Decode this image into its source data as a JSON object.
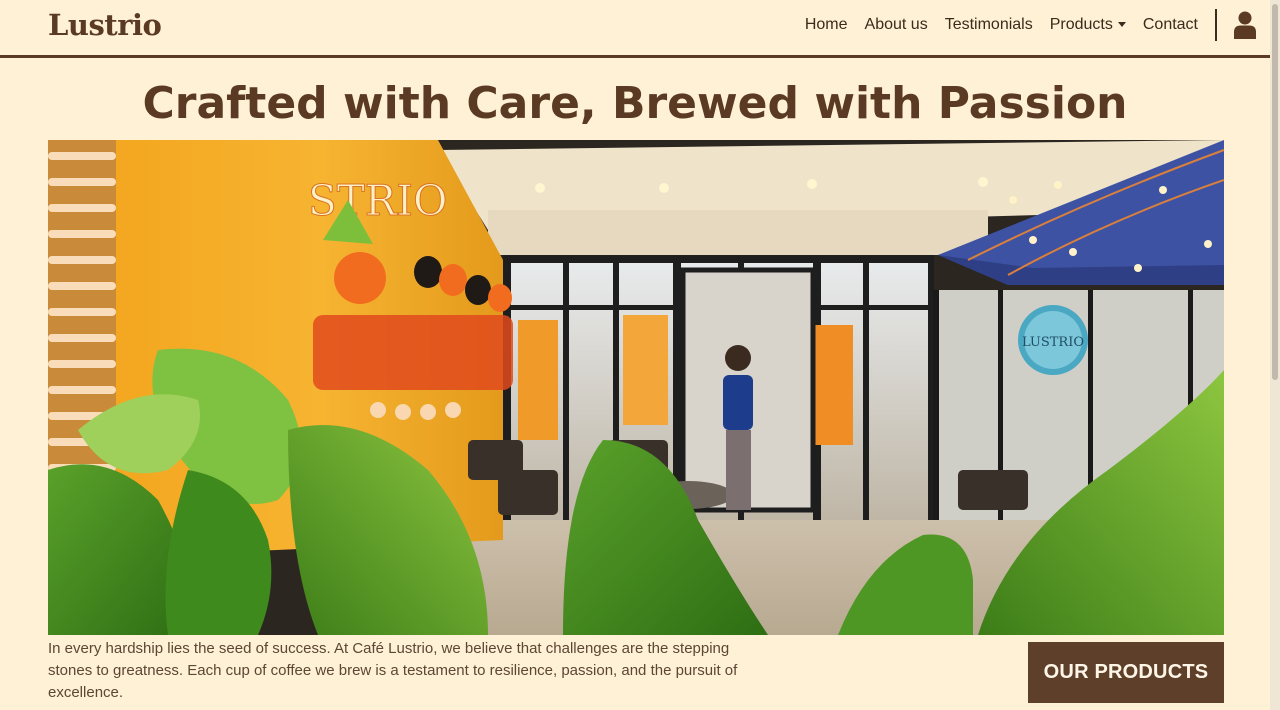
{
  "header": {
    "brand": "Lustrio",
    "nav": [
      "Home",
      "About us",
      "Testimonials",
      "Products",
      "Contact"
    ]
  },
  "hero": {
    "title": "Crafted with Care, Brewed with Passion",
    "image_icon": "cafe-storefront-photo",
    "photo_signs": {
      "wall_logo": "STRIO",
      "window_logo": "LUSTRIO"
    }
  },
  "intro": {
    "text": "In every hardship lies the seed of success. At Café Lustrio, we believe that challenges are the stepping stones to greatness. Each cup of coffee we brew is a testament to resilience, passion, and the pursuit of excellence."
  },
  "cta": {
    "label": "OUR PRODUCTS"
  },
  "colors": {
    "background": "#fff1d6",
    "brand": "#5a3a22",
    "button": "#5e3f2a"
  }
}
